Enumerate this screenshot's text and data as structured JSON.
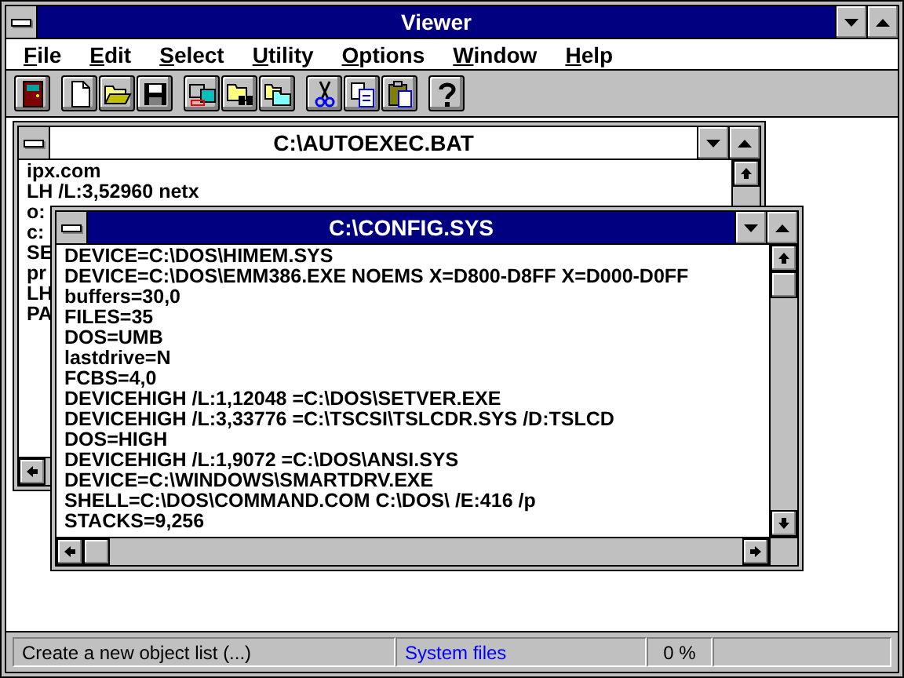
{
  "window": {
    "title": "Viewer"
  },
  "menu": [
    {
      "label": "File"
    },
    {
      "label": "Edit"
    },
    {
      "label": "Select"
    },
    {
      "label": "Utility"
    },
    {
      "label": "Options"
    },
    {
      "label": "Window"
    },
    {
      "label": "Help"
    }
  ],
  "documents": [
    {
      "title": "C:\\AUTOEXEC.BAT",
      "active": false,
      "lines": [
        "ipx.com",
        "LH /L:3,52960 netx",
        "o:",
        "c:",
        "SE",
        "pr",
        "LH",
        "PA"
      ]
    },
    {
      "title": "C:\\CONFIG.SYS",
      "active": true,
      "lines": [
        "DEVICE=C:\\DOS\\HIMEM.SYS",
        "DEVICE=C:\\DOS\\EMM386.EXE NOEMS X=D800-D8FF X=D000-D0FF",
        "buffers=30,0",
        "FILES=35",
        "DOS=UMB",
        "lastdrive=N",
        "FCBS=4,0",
        "DEVICEHIGH /L:1,12048 =C:\\DOS\\SETVER.EXE",
        "DEVICEHIGH /L:3,33776 =C:\\TSCSI\\TSLCDR.SYS /D:TSLCD",
        "DOS=HIGH",
        "DEVICEHIGH /L:1,9072 =C:\\DOS\\ANSI.SYS",
        "DEVICE=C:\\WINDOWS\\SMARTDRV.EXE",
        "SHELL=C:\\DOS\\COMMAND.COM C:\\DOS\\ /E:416 /p",
        "STACKS=9,256"
      ]
    }
  ],
  "status_bar": [
    {
      "text": "Create a new object list (...)",
      "kind": "message"
    },
    {
      "text": "System files",
      "kind": "info"
    },
    {
      "text": "0 %",
      "kind": "percent"
    }
  ]
}
